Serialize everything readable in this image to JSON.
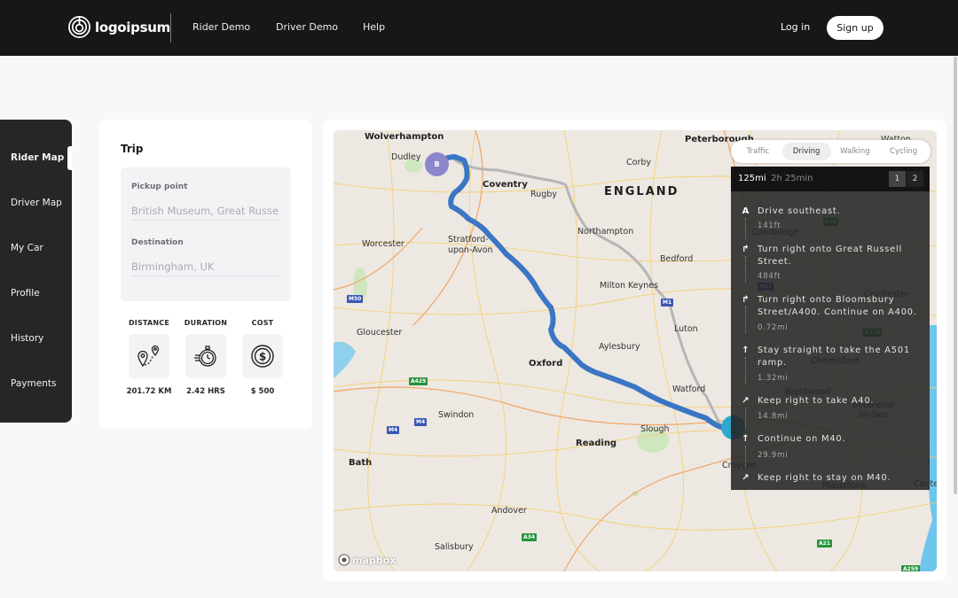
{
  "header": {
    "logo_text": "logoipsum",
    "nav": [
      "Rider Demo",
      "Driver Demo",
      "Help"
    ],
    "login_label": "Log in",
    "signup_label": "Sign up"
  },
  "sidebar": {
    "items": [
      {
        "label": "Rider Map",
        "active": true
      },
      {
        "label": "Driver Map",
        "active": false
      },
      {
        "label": "My Car",
        "active": false
      },
      {
        "label": "Profile",
        "active": false
      },
      {
        "label": "History",
        "active": false
      },
      {
        "label": "Payments",
        "active": false
      }
    ]
  },
  "trip": {
    "title": "Trip",
    "pickup": {
      "label": "Pickup point",
      "value": "British Museum, Great Russe"
    },
    "destination": {
      "label": "Destination",
      "value": "Birmingham, UK"
    },
    "stats": [
      {
        "label": "DISTANCE",
        "value": "201.72 KM",
        "icon": "route-pins-icon"
      },
      {
        "label": "DURATION",
        "value": "2.42 HRS",
        "icon": "stopwatch-icon"
      },
      {
        "label": "COST",
        "value": "$ 500",
        "icon": "dollar-coin-icon"
      }
    ]
  },
  "map": {
    "attribution": "mapbox",
    "markers": {
      "origin": "A",
      "destination": "B"
    },
    "route_color": "#3a76c4",
    "alt_route_color": "#b5b5b5",
    "country_label": "ENGLAND",
    "cities": [
      {
        "name": "Wolverhampton",
        "big": true
      },
      {
        "name": "Dudley",
        "big": false
      },
      {
        "name": "Coventry",
        "big": true
      },
      {
        "name": "Rugby",
        "big": false
      },
      {
        "name": "Corby",
        "big": false
      },
      {
        "name": "Peterborough",
        "big": true
      },
      {
        "name": "Northampton",
        "big": false
      },
      {
        "name": "Stratford-",
        "big": false
      },
      {
        "name": "upon-Avon",
        "big": false
      },
      {
        "name": "Worcester",
        "big": false
      },
      {
        "name": "Bedford",
        "big": false
      },
      {
        "name": "Milton Keynes",
        "big": false
      },
      {
        "name": "Gloucester",
        "big": false
      },
      {
        "name": "Luton",
        "big": false
      },
      {
        "name": "Oxford",
        "big": true
      },
      {
        "name": "Aylesbury",
        "big": false
      },
      {
        "name": "Watford",
        "big": false
      },
      {
        "name": "Swindon",
        "big": false
      },
      {
        "name": "Slough",
        "big": false
      },
      {
        "name": "Reading",
        "big": true
      },
      {
        "name": "Bath",
        "big": true
      },
      {
        "name": "Andover",
        "big": false
      },
      {
        "name": "Salisbury",
        "big": false
      },
      {
        "name": "Croydon",
        "big": false
      },
      {
        "name": "Cambridge",
        "big": false
      },
      {
        "name": "Colchester",
        "big": false
      },
      {
        "name": "Chelmsford",
        "big": false
      },
      {
        "name": "Brentwood",
        "big": false
      },
      {
        "name": "Southend-",
        "big": false
      },
      {
        "name": "on-Sea",
        "big": false
      },
      {
        "name": "Maidstone",
        "big": false
      },
      {
        "name": "Cante",
        "big": false
      },
      {
        "name": "Watton",
        "big": false
      }
    ],
    "road_shields": [
      {
        "label": "M50",
        "type": "blue"
      },
      {
        "label": "A429",
        "type": "green"
      },
      {
        "label": "M4",
        "type": "blue"
      },
      {
        "label": "M4",
        "type": "blue"
      },
      {
        "label": "A34",
        "type": "green"
      },
      {
        "label": "M1",
        "type": "blue"
      },
      {
        "label": "A14",
        "type": "green"
      },
      {
        "label": "M11",
        "type": "blue"
      },
      {
        "label": "A120",
        "type": "green"
      },
      {
        "label": "A21",
        "type": "green"
      },
      {
        "label": "A259",
        "type": "green"
      }
    ]
  },
  "directions": {
    "profiles": [
      {
        "label": "Traffic",
        "active": false
      },
      {
        "label": "Driving",
        "active": true
      },
      {
        "label": "Walking",
        "active": false
      },
      {
        "label": "Cycling",
        "active": false
      }
    ],
    "summary_distance": "125mi",
    "summary_duration": "2h 25min",
    "alternatives": [
      "1",
      "2"
    ],
    "steps": [
      {
        "icon": "A",
        "text": "Drive southeast.",
        "distance": "141ft"
      },
      {
        "icon": "turn-right",
        "text": "Turn right onto Great Russell Street.",
        "distance": "484ft"
      },
      {
        "icon": "turn-right",
        "text": "Turn right onto Bloomsbury Street/A400. Continue on A400.",
        "distance": "0.72mi"
      },
      {
        "icon": "straight",
        "text": "Stay straight to take the A501 ramp.",
        "distance": "1.32mi"
      },
      {
        "icon": "keep-right",
        "text": "Keep right to take A40.",
        "distance": "14.8mi"
      },
      {
        "icon": "straight",
        "text": "Continue on M40.",
        "distance": "29.9mi"
      },
      {
        "icon": "keep-right",
        "text": "Keep right to stay on M40.",
        "distance": ""
      }
    ]
  }
}
